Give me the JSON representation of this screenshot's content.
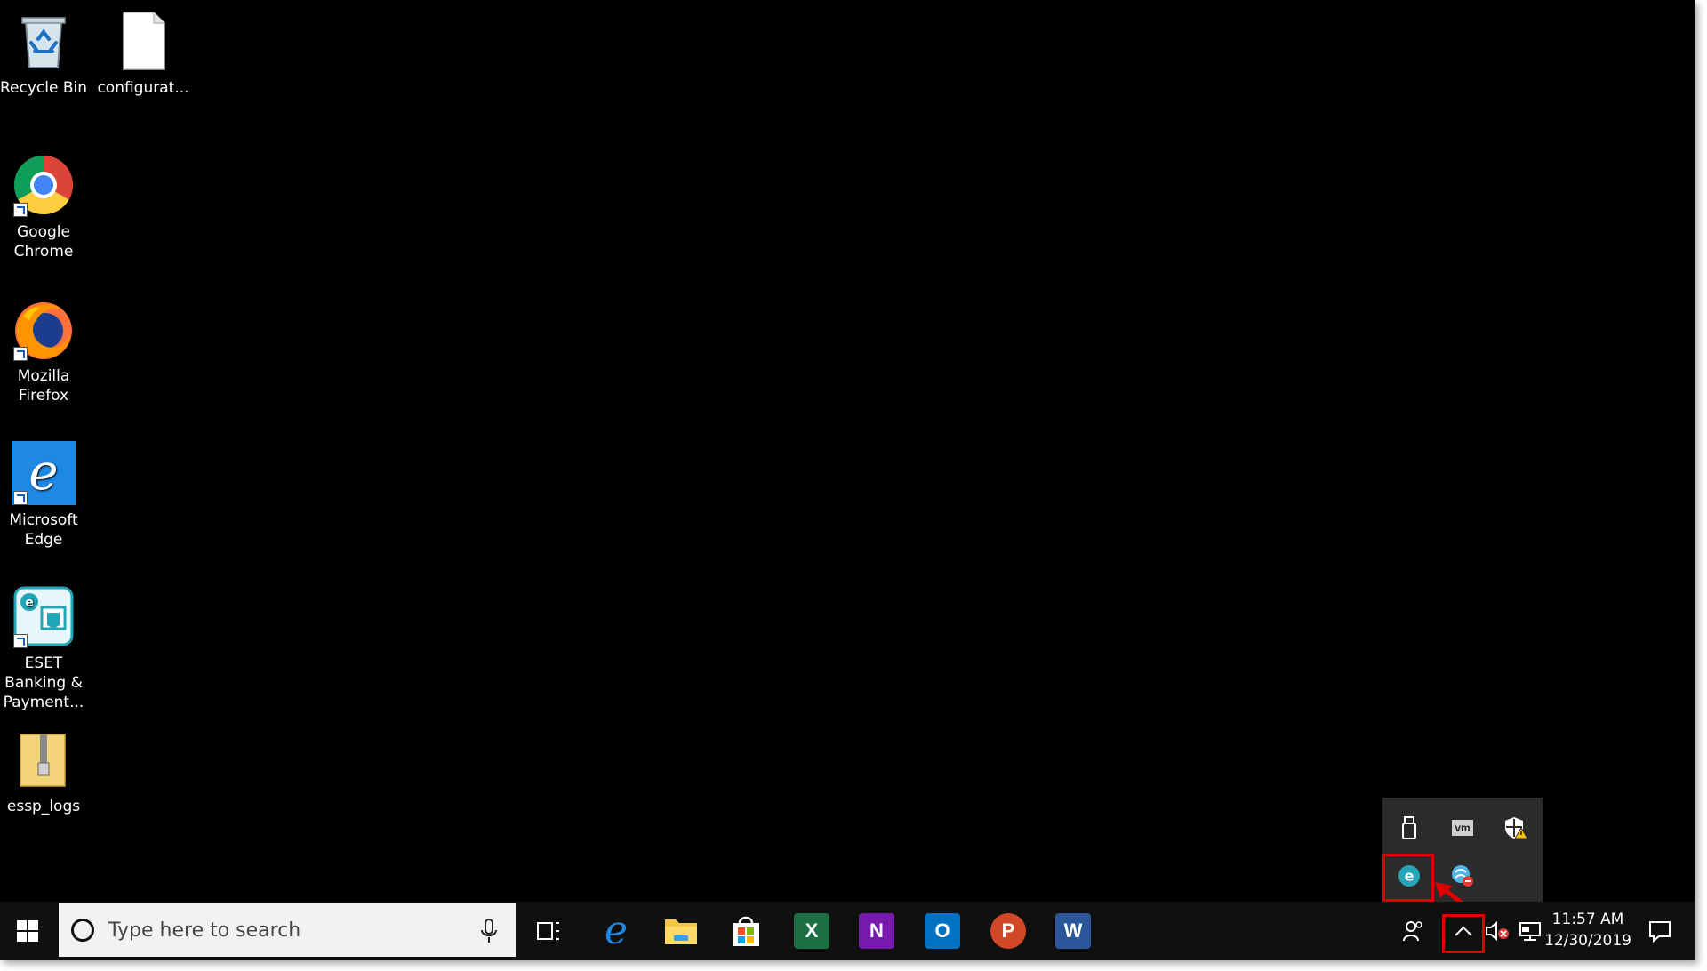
{
  "desktop": {
    "icons": [
      {
        "label": "Recycle Bin",
        "icon": "recycle-bin-icon"
      },
      {
        "label": "configurat...",
        "icon": "file-icon"
      },
      {
        "label": "Google Chrome",
        "icon": "chrome-icon"
      },
      {
        "label": "Mozilla Firefox",
        "icon": "firefox-icon"
      },
      {
        "label": "Microsoft Edge",
        "icon": "edge-icon"
      },
      {
        "label": "ESET Banking & Payment...",
        "icon": "eset-banking-icon"
      },
      {
        "label": "essp_logs",
        "icon": "zip-folder-icon"
      }
    ]
  },
  "taskbar": {
    "search_placeholder": "Type here to search",
    "pinned_apps": [
      {
        "name": "task-view",
        "icon": "task-view-icon"
      },
      {
        "name": "edge",
        "icon": "edge-icon"
      },
      {
        "name": "file-explorer",
        "icon": "folder-icon"
      },
      {
        "name": "store",
        "icon": "store-icon",
        "color": "#ffffff"
      },
      {
        "name": "excel",
        "icon": "excel-icon",
        "letter": "X",
        "color": "#1d6f42"
      },
      {
        "name": "onenote",
        "icon": "onenote-icon",
        "letter": "N",
        "color": "#7719aa"
      },
      {
        "name": "outlook",
        "icon": "outlook-icon",
        "letter": "O",
        "color": "#0072c6"
      },
      {
        "name": "powerpoint",
        "icon": "powerpoint-icon",
        "letter": "P",
        "color": "#d24726"
      },
      {
        "name": "word",
        "icon": "word-icon",
        "letter": "W",
        "color": "#2b579a"
      }
    ],
    "clock": {
      "time": "11:57 AM",
      "date": "12/30/2019"
    }
  },
  "tray_popup": {
    "icons": [
      "usb-drive-icon",
      "vmware-icon",
      "security-warning-icon",
      "eset-icon",
      "eset-network-icon"
    ],
    "vm_label": "vm"
  },
  "colors": {
    "highlight": "#e00000",
    "desktop_bg": "#000000",
    "taskbar_bg": "#101010"
  }
}
